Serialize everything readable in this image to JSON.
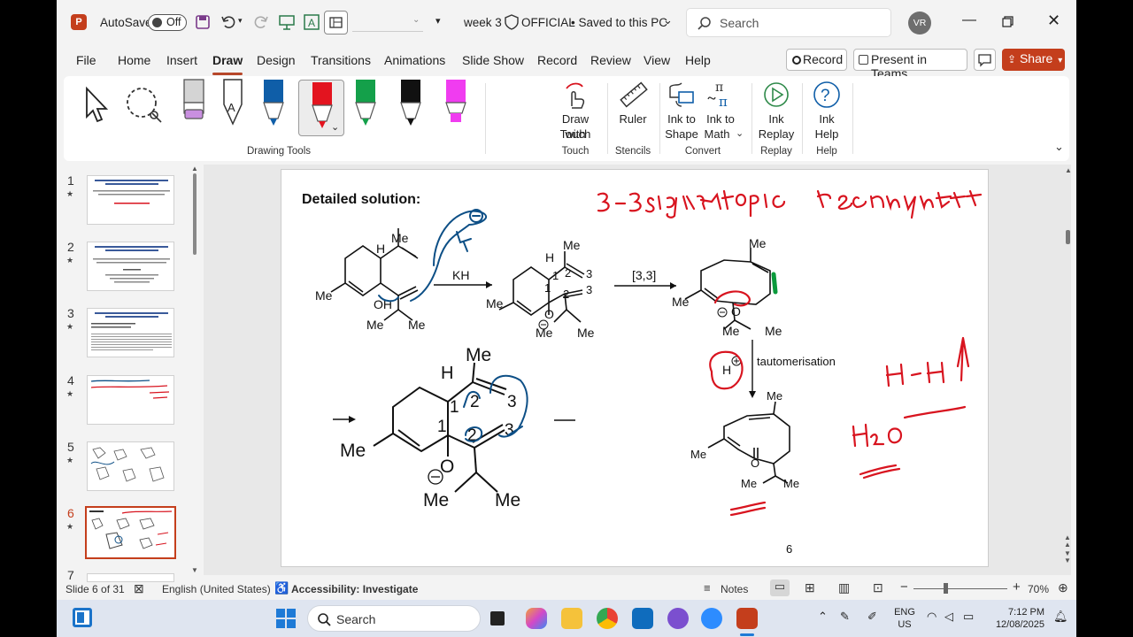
{
  "titlebar": {
    "autosave_label": "AutoSave",
    "autosave_state": "Off",
    "doc_title": "week 3",
    "sensitivity": "OFFICIAL",
    "save_status": "• Saved to this PC",
    "search_placeholder": "Search",
    "user_initials": "VR"
  },
  "menu": {
    "tabs": [
      "File",
      "Home",
      "Insert",
      "Draw",
      "Design",
      "Transitions",
      "Animations",
      "Slide Show",
      "Record",
      "Review",
      "View",
      "Help"
    ],
    "active": "Draw",
    "record_btn": "Record",
    "teams_btn": "Present in Teams",
    "share_btn": "Share"
  },
  "ribbon": {
    "drawing_tools_label": "Drawing Tools",
    "draw_with_touch_1": "Draw with",
    "draw_with_touch_2": "Touch",
    "touch_group": "Touch",
    "ruler": "Ruler",
    "stencils_group": "Stencils",
    "ink_to_shape_1": "Ink to",
    "ink_to_shape_2": "Shape",
    "ink_to_math_1": "Ink to",
    "ink_to_math_2": "Math",
    "convert_group": "Convert",
    "ink_replay_1": "Ink",
    "ink_replay_2": "Replay",
    "replay_group": "Replay",
    "ink_help_1": "Ink",
    "ink_help_2": "Help",
    "help_group": "Help",
    "pen_colors": [
      "#0f5ea8",
      "#e3141f",
      "#14a04a",
      "#111111",
      "#f03cf0"
    ],
    "highlighter_color": "#c98fe0"
  },
  "thumbnails": {
    "numbers": [
      "1",
      "2",
      "3",
      "4",
      "5",
      "6",
      "7"
    ],
    "selected": "6"
  },
  "slide": {
    "heading": "Detailed solution:",
    "page_number": "6",
    "labels": {
      "me": "Me",
      "h": "H",
      "oh": "OH",
      "o": "O",
      "kh": "KH",
      "shift": "[3,3]",
      "tautomerisation": "tautomerisation",
      "n1": "1",
      "n2": "2",
      "n3": "3"
    },
    "ink_colors": {
      "blue": "#0d4f86",
      "red": "#d8141f",
      "green": "#0b9a3c"
    }
  },
  "status": {
    "slide_info": "Slide 6 of 31",
    "language": "English (United States)",
    "accessibility": "Accessibility: Investigate",
    "notes": "Notes",
    "zoom": "70%"
  },
  "taskbar": {
    "search_placeholder": "Search",
    "lang_1": "ENG",
    "lang_2": "US",
    "time": "7:12 PM",
    "date": "12/08/2025"
  }
}
